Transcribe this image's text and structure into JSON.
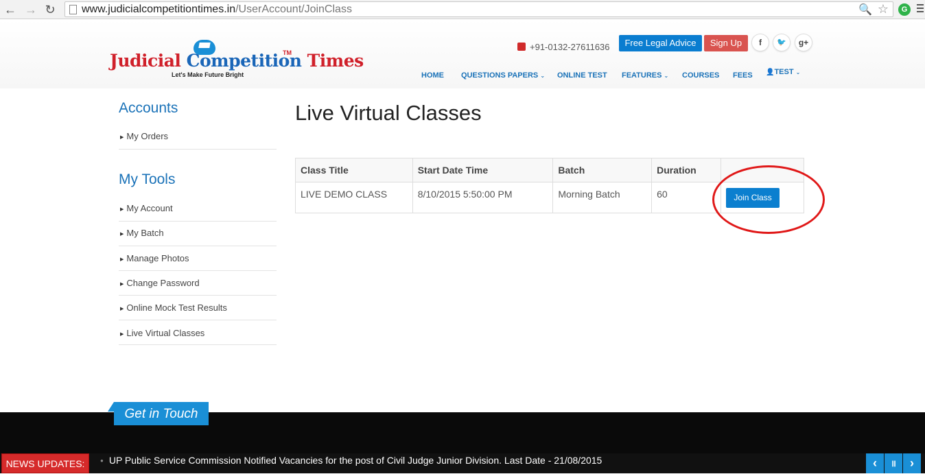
{
  "browser": {
    "url_domain": "www.judicialcompetitiontimes.in",
    "url_path": "/UserAccount/JoinClass",
    "back_glyph": "←",
    "forward_glyph": "→",
    "reload_glyph": "↻",
    "zoom_glyph": "🔍",
    "star_glyph": "☆",
    "ext_glyph": "G"
  },
  "header": {
    "logo_word1": "Judicial ",
    "logo_word2": "Competition",
    "logo_word3": " Times",
    "logo_tm": "TM",
    "logo_tagline": "Let's Make Future Bright",
    "phone": "+91-0132-27611636",
    "free_legal_advice": "Free Legal Advice",
    "sign_up": "Sign Up",
    "social": {
      "facebook": "f",
      "twitter": "🐦",
      "googleplus": "g+"
    }
  },
  "nav": {
    "home": "HOME",
    "questions_papers": "QUESTIONS PAPERS",
    "online_test": "ONLINE TEST",
    "features": "FEATURES",
    "courses": "COURSES",
    "fees": "FEES",
    "user": "TEST",
    "caret": "⌄",
    "user_glyph": "👤"
  },
  "sidebar": {
    "accounts_heading": "Accounts",
    "accounts_items": [
      "My Orders"
    ],
    "tools_heading": "My Tools",
    "tools_items": [
      "My Account",
      "My Batch",
      "Manage Photos",
      "Change Password",
      "Online Mock Test Results",
      "Live Virtual Classes"
    ],
    "bullet": "▶"
  },
  "main": {
    "title": "Live Virtual Classes",
    "table": {
      "headers": [
        "Class Title",
        "Start Date Time",
        "Batch",
        "Duration",
        ""
      ],
      "rows": [
        {
          "class_title": "LIVE DEMO CLASS",
          "start": "8/10/2015 5:50:00 PM",
          "batch": "Morning Batch",
          "duration": "60",
          "action": "Join Class"
        }
      ]
    }
  },
  "footer": {
    "get_in_touch": "Get in Touch",
    "news_label": "NEWS UPDATES:",
    "news_text": "UP Public Service Commission Notified Vacancies for the post of Civil Judge Junior Division. Last Date - 21/08/2015",
    "ticker_dot": "●",
    "prev": "‹",
    "pause": "॥",
    "next": "›"
  },
  "colors": {
    "brand_blue": "#1a72b8",
    "button_blue": "#0b7fcf",
    "signup_red": "#d9534f",
    "logo_red": "#d0202a",
    "highlight_red": "#e01818"
  }
}
